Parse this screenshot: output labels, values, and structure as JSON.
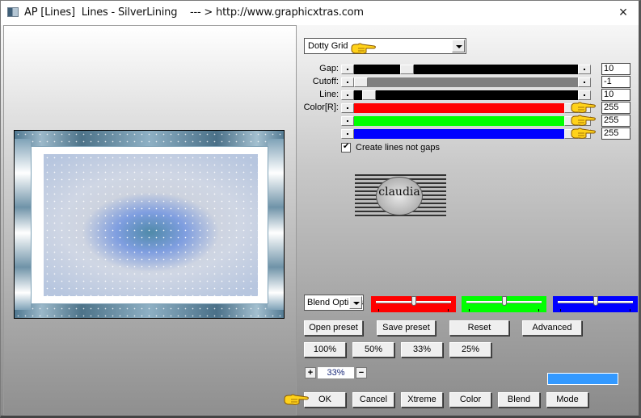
{
  "window": {
    "title": "AP [Lines]  Lines - SilverLining    --- > http://www.graphicxtras.com",
    "close_icon": "×"
  },
  "preset": {
    "selected": "Dotty Grid"
  },
  "sliders": [
    {
      "label": "Gap:",
      "value": "10",
      "track_color": "#000000",
      "position": 0.22
    },
    {
      "label": "Cutoff:",
      "value": "-1",
      "track_color": "#808080",
      "position": 0.0
    },
    {
      "label": "Line:",
      "value": "10",
      "track_color": "#000000",
      "position": 0.04
    },
    {
      "label": "Color[R]:",
      "value": "255",
      "track_color": "#ff0000",
      "position": 1.0
    },
    {
      "label": "",
      "value": "255",
      "track_color": "#00ff00",
      "position": 1.0
    },
    {
      "label": "",
      "value": "255",
      "track_color": "#0000ff",
      "position": 1.0
    }
  ],
  "checkbox": {
    "label": "Create lines not gaps",
    "checked": true
  },
  "logo": {
    "text": "claudia"
  },
  "blend": {
    "selected": "Blend Options",
    "color_sliders": [
      {
        "color": "#ff0000",
        "position": 0.5
      },
      {
        "color": "#00ff00",
        "position": 0.5
      },
      {
        "color": "#0000ff",
        "position": 0.5
      }
    ]
  },
  "buttons": {
    "open_preset": "Open preset",
    "save_preset": "Save preset",
    "reset": "Reset",
    "advanced": "Advanced",
    "z100": "100%",
    "z50": "50%",
    "z33": "33%",
    "z25": "25%",
    "ok": "OK",
    "cancel": "Cancel",
    "xtreme": "Xtreme",
    "color": "Color",
    "blend": "Blend",
    "mode": "Mode"
  },
  "zoom": {
    "plus": "+",
    "value": "33%",
    "minus": "−"
  },
  "swatch_color": "#3399ff"
}
